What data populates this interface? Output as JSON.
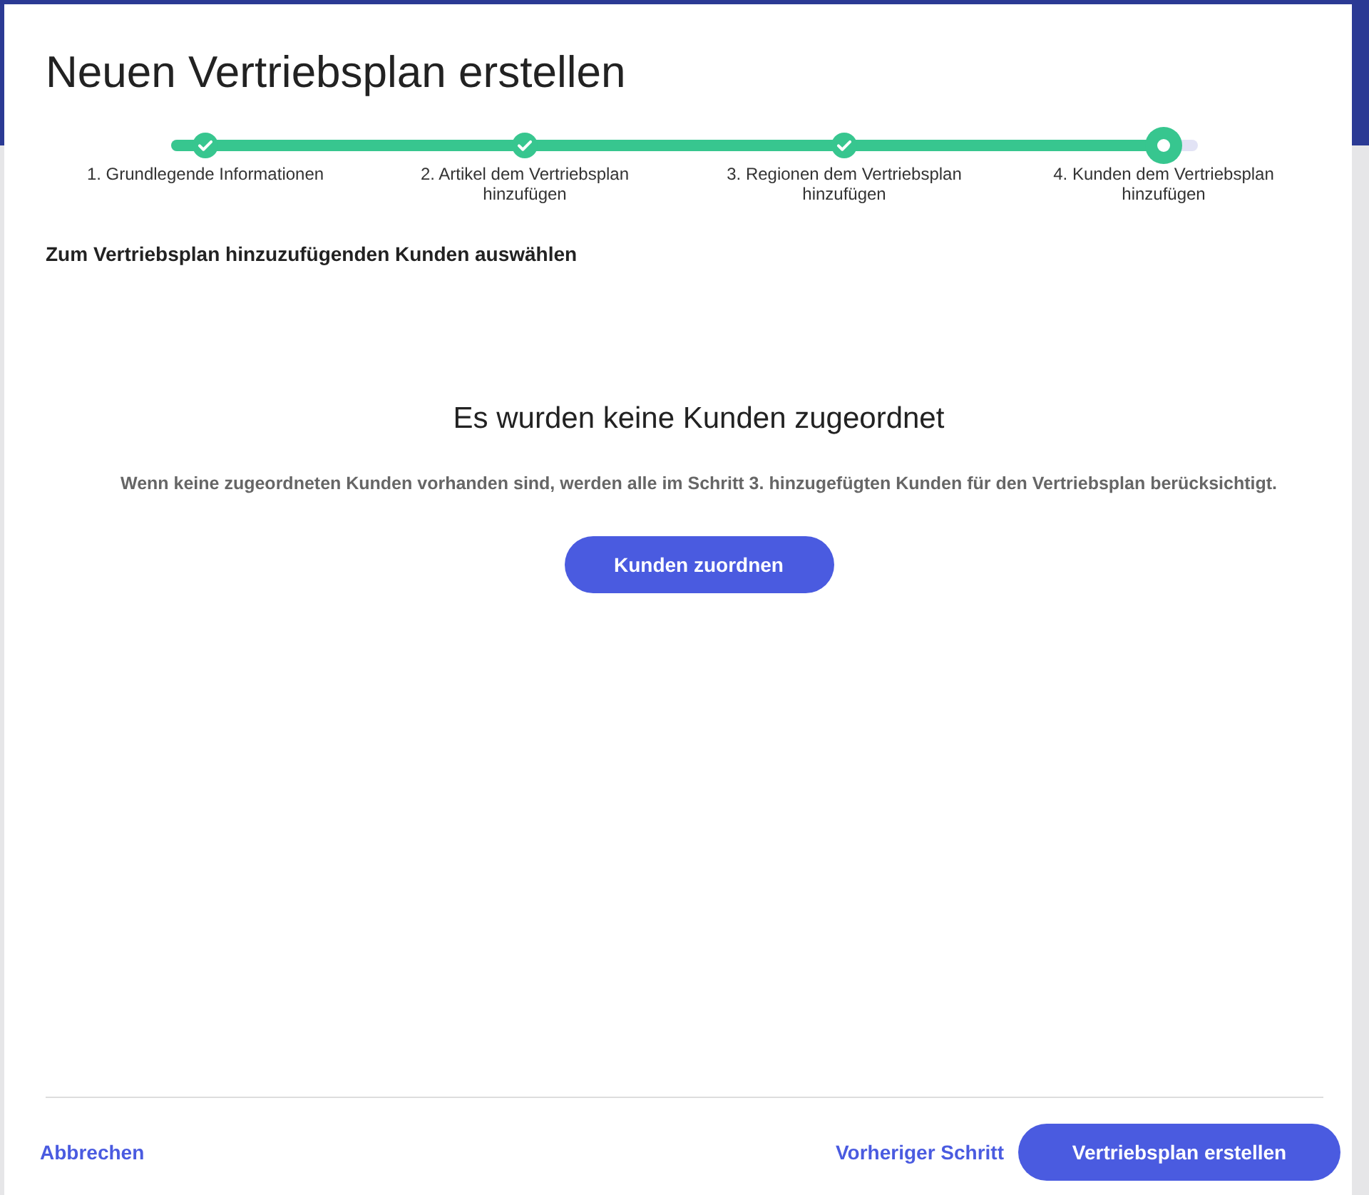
{
  "dialog": {
    "title": "Neuen Vertriebsplan erstellen"
  },
  "stepper": {
    "level": 0.967,
    "steps": [
      {
        "label": "1. Grundlegende Informationen",
        "kind": "done"
      },
      {
        "label": "2. Artikel dem Vertriebsplan hinzufügen",
        "kind": "done"
      },
      {
        "label": "3. Regionen dem Vertriebsplan hinzufügen",
        "kind": "done"
      },
      {
        "label": "4. Kunden dem Vertriebsplan hinzufügen",
        "kind": "current"
      }
    ]
  },
  "section_title": "Zum Vertriebsplan hinzuzufügenden Kunden auswählen",
  "empty_state": {
    "heading": "Es wurden keine Kunden zugeordnet",
    "message": "Wenn keine zugeordneten Kunden vorhanden sind, werden alle im Schritt 3. hinzugefügten Kunden für den Vertriebsplan berücksichtigt.",
    "button": "Kunden zuordnen"
  },
  "footer": {
    "cancel": "Abbrechen",
    "previous": "Vorheriger Schritt",
    "submit": "Vertriebsplan erstellen"
  }
}
